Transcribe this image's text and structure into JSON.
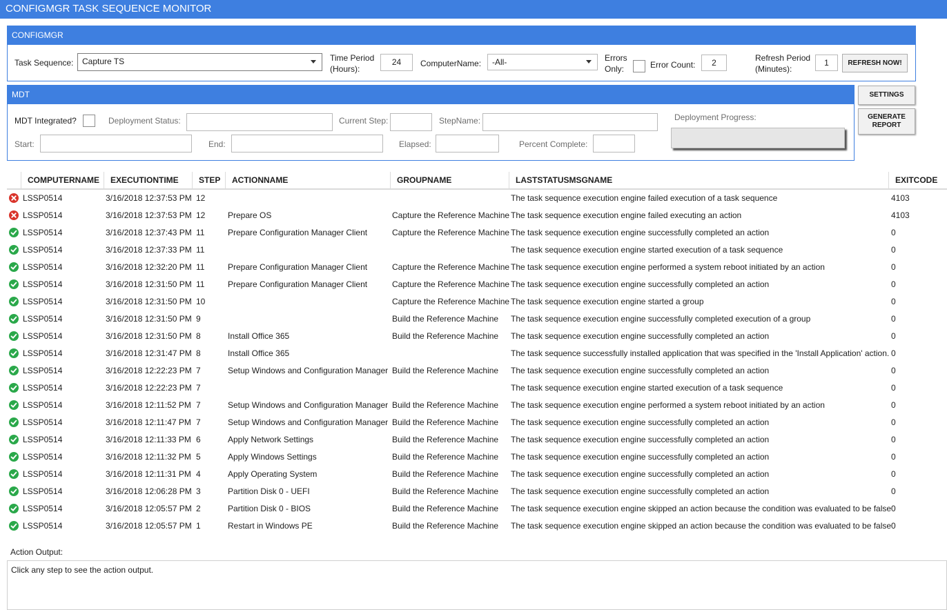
{
  "window": {
    "title": "CONFIGMGR TASK SEQUENCE MONITOR"
  },
  "configmgr": {
    "header": "CONFIGMGR",
    "task_sequence_label": "Task Sequence:",
    "task_sequence_value": "Capture TS",
    "time_period_label_1": "Time Period",
    "time_period_label_2": "(Hours):",
    "time_period_value": "24",
    "computer_name_label": "ComputerName:",
    "computer_name_value": "-All-",
    "errors_only_label_1": "Errors",
    "errors_only_label_2": "Only:",
    "error_count_label": "Error Count:",
    "error_count_value": "2",
    "refresh_period_label_1": "Refresh Period",
    "refresh_period_label_2": "(Minutes):",
    "refresh_period_value": "1",
    "refresh_button": "REFRESH NOW!"
  },
  "mdt": {
    "header": "MDT",
    "integrated_label": "MDT Integrated?",
    "deployment_status_label": "Deployment Status:",
    "current_step_label": "Current Step:",
    "step_name_label": "StepName:",
    "start_label": "Start:",
    "end_label": "End:",
    "elapsed_label": "Elapsed:",
    "percent_complete_label": "Percent Complete:",
    "deployment_progress_label": "Deployment Progress:",
    "deployment_progress_value": 0
  },
  "buttons": {
    "settings": "SETTINGS",
    "generate_report_1": "GENERATE",
    "generate_report_2": "REPORT"
  },
  "colors": {
    "accent": "#3e7fe0",
    "error": "#d9342b",
    "success": "#2aa84a"
  },
  "grid": {
    "columns": [
      "COMPUTERNAME",
      "EXECUTIONTIME",
      "STEP",
      "ACTIONNAME",
      "GROUPNAME",
      "LASTSTATUSMSGNAME",
      "EXITCODE"
    ],
    "rows": [
      {
        "status": "error",
        "computer": "LSSP0514",
        "time": "3/16/2018 12:37:53 PM",
        "step": "12",
        "action": "",
        "group": "",
        "message": "The task sequence execution engine failed execution of a task sequence",
        "exit": "4103"
      },
      {
        "status": "error",
        "computer": "LSSP0514",
        "time": "3/16/2018 12:37:53 PM",
        "step": "12",
        "action": "Prepare OS",
        "group": "Capture the Reference Machine",
        "message": "The task sequence execution engine failed executing an action",
        "exit": "4103"
      },
      {
        "status": "success",
        "computer": "LSSP0514",
        "time": "3/16/2018 12:37:43 PM",
        "step": "11",
        "action": "Prepare Configuration Manager Client",
        "group": "Capture the Reference Machine",
        "message": "The task sequence execution engine successfully completed an action",
        "exit": "0"
      },
      {
        "status": "success",
        "computer": "LSSP0514",
        "time": "3/16/2018 12:37:33 PM",
        "step": "11",
        "action": "",
        "group": "",
        "message": "The task sequence execution engine started execution of a task sequence",
        "exit": "0"
      },
      {
        "status": "success",
        "computer": "LSSP0514",
        "time": "3/16/2018 12:32:20 PM",
        "step": "11",
        "action": "Prepare Configuration Manager Client",
        "group": "Capture the Reference Machine",
        "message": "The task sequence execution engine performed a system reboot initiated by an action",
        "exit": "0"
      },
      {
        "status": "success",
        "computer": "LSSP0514",
        "time": "3/16/2018 12:31:50 PM",
        "step": "11",
        "action": "Prepare Configuration Manager Client",
        "group": "Capture the Reference Machine",
        "message": "The task sequence execution engine successfully completed an action",
        "exit": "0"
      },
      {
        "status": "success",
        "computer": "LSSP0514",
        "time": "3/16/2018 12:31:50 PM",
        "step": "10",
        "action": "",
        "group": "Capture the Reference Machine",
        "message": "The task sequence execution engine started a group",
        "exit": "0"
      },
      {
        "status": "success",
        "computer": "LSSP0514",
        "time": "3/16/2018 12:31:50 PM",
        "step": "9",
        "action": "",
        "group": "Build the Reference Machine",
        "message": "The task sequence execution engine successfully completed execution of a group",
        "exit": "0"
      },
      {
        "status": "success",
        "computer": "LSSP0514",
        "time": "3/16/2018 12:31:50 PM",
        "step": "8",
        "action": "Install Office 365",
        "group": "Build the Reference Machine",
        "message": "The task sequence execution engine successfully completed an action",
        "exit": "0"
      },
      {
        "status": "success",
        "computer": "LSSP0514",
        "time": "3/16/2018 12:31:47 PM",
        "step": "8",
        "action": "Install Office 365",
        "group": "",
        "message": "The task sequence successfully installed application that was specified in the 'Install Application' action.",
        "exit": "0"
      },
      {
        "status": "success",
        "computer": "LSSP0514",
        "time": "3/16/2018 12:22:23 PM",
        "step": "7",
        "action": "Setup Windows and Configuration Manager",
        "group": "Build the Reference Machine",
        "message": "The task sequence execution engine successfully completed an action",
        "exit": "0"
      },
      {
        "status": "success",
        "computer": "LSSP0514",
        "time": "3/16/2018 12:22:23 PM",
        "step": "7",
        "action": "",
        "group": "",
        "message": "The task sequence execution engine started execution of a task sequence",
        "exit": "0"
      },
      {
        "status": "success",
        "computer": "LSSP0514",
        "time": "3/16/2018 12:11:52 PM",
        "step": "7",
        "action": "Setup Windows and Configuration Manager",
        "group": "Build the Reference Machine",
        "message": "The task sequence execution engine performed a system reboot initiated by an action",
        "exit": "0"
      },
      {
        "status": "success",
        "computer": "LSSP0514",
        "time": "3/16/2018 12:11:47 PM",
        "step": "7",
        "action": "Setup Windows and Configuration Manager",
        "group": "Build the Reference Machine",
        "message": "The task sequence execution engine successfully completed an action",
        "exit": "0"
      },
      {
        "status": "success",
        "computer": "LSSP0514",
        "time": "3/16/2018 12:11:33 PM",
        "step": "6",
        "action": "Apply Network Settings",
        "group": "Build the Reference Machine",
        "message": "The task sequence execution engine successfully completed an action",
        "exit": "0"
      },
      {
        "status": "success",
        "computer": "LSSP0514",
        "time": "3/16/2018 12:11:32 PM",
        "step": "5",
        "action": "Apply Windows Settings",
        "group": "Build the Reference Machine",
        "message": "The task sequence execution engine successfully completed an action",
        "exit": "0"
      },
      {
        "status": "success",
        "computer": "LSSP0514",
        "time": "3/16/2018 12:11:31 PM",
        "step": "4",
        "action": "Apply Operating System",
        "group": "Build the Reference Machine",
        "message": "The task sequence execution engine successfully completed an action",
        "exit": "0"
      },
      {
        "status": "success",
        "computer": "LSSP0514",
        "time": "3/16/2018 12:06:28 PM",
        "step": "3",
        "action": "Partition Disk 0 - UEFI",
        "group": "Build the Reference Machine",
        "message": "The task sequence execution engine successfully completed an action",
        "exit": "0"
      },
      {
        "status": "success",
        "computer": "LSSP0514",
        "time": "3/16/2018 12:05:57 PM",
        "step": "2",
        "action": "Partition Disk 0 - BIOS",
        "group": "Build the Reference Machine",
        "message": "The task sequence execution engine skipped an action because the condition was evaluated to be false",
        "exit": "0"
      },
      {
        "status": "success",
        "computer": "LSSP0514",
        "time": "3/16/2018 12:05:57 PM",
        "step": "1",
        "action": "Restart in Windows PE",
        "group": "Build the Reference Machine",
        "message": "The task sequence execution engine skipped an action because the condition was evaluated to be false",
        "exit": "0"
      }
    ]
  },
  "output": {
    "label": "Action Output:",
    "text": "Click any step to see the action output."
  }
}
